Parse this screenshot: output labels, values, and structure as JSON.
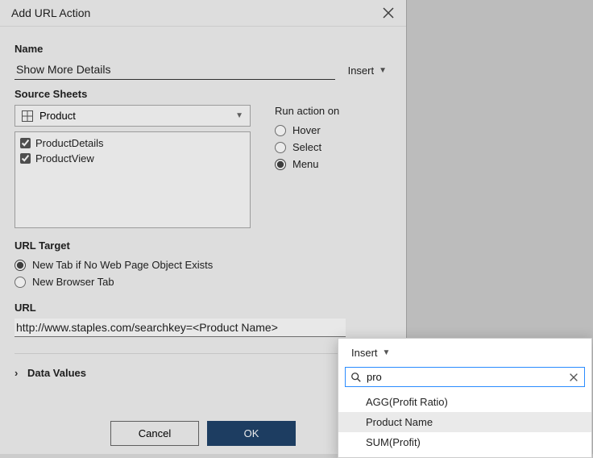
{
  "title": "Add URL Action",
  "labels": {
    "name": "Name",
    "insert": "Insert",
    "source_sheets": "Source Sheets",
    "run_action_on": "Run action on",
    "url_target": "URL Target",
    "url": "URL",
    "data_values": "Data Values",
    "cancel": "Cancel",
    "ok": "OK"
  },
  "name_field": {
    "value": "Show More Details"
  },
  "source_dropdown": {
    "value": "Product"
  },
  "sheets": [
    {
      "label": "ProductDetails",
      "checked": true
    },
    {
      "label": "ProductView",
      "checked": true
    }
  ],
  "run_options": [
    {
      "label": "Hover",
      "checked": false
    },
    {
      "label": "Select",
      "checked": false
    },
    {
      "label": "Menu",
      "checked": true
    }
  ],
  "url_target_options": [
    {
      "label": "New Tab if No Web Page Object Exists",
      "checked": true
    },
    {
      "label": "New Browser Tab",
      "checked": false
    }
  ],
  "url_field": {
    "value": "http://www.staples.com/searchkey=<Product Name>"
  },
  "popover": {
    "insert_label": "Insert",
    "search_value": "pro",
    "options": [
      {
        "label": "AGG(Profit Ratio)",
        "selected": false
      },
      {
        "label": "Product Name",
        "selected": true
      },
      {
        "label": "SUM(Profit)",
        "selected": false
      }
    ]
  }
}
